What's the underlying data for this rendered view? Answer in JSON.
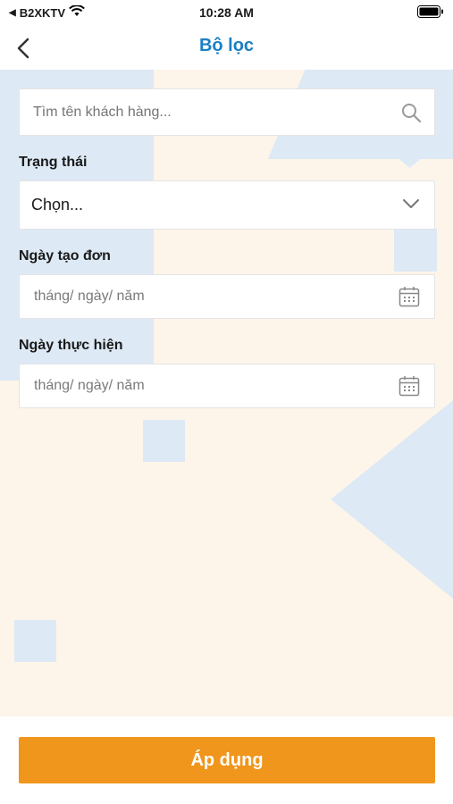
{
  "status_bar": {
    "carrier": "B2XKTV",
    "time": "10:28 AM"
  },
  "nav": {
    "title": "Bộ lọc"
  },
  "search": {
    "placeholder": "Tìm tên khách hàng..."
  },
  "filters": {
    "status_label": "Trạng thái",
    "status_value": "Chọn...",
    "created_date_label": "Ngày tạo đơn",
    "created_date_placeholder": "tháng/ ngày/ năm",
    "execution_date_label": "Ngày thực hiện",
    "execution_date_placeholder": "tháng/ ngày/ năm"
  },
  "actions": {
    "apply_label": "Áp dụng"
  },
  "colors": {
    "title": "#1c7fc4",
    "apply_button": "#f0961d",
    "background": "#fdf5ea",
    "accent_shape": "#dde9f5"
  },
  "icons": {
    "back": "chevron-left-icon",
    "search": "search-icon",
    "select": "chevron-down-icon",
    "date": "calendar-icon"
  }
}
